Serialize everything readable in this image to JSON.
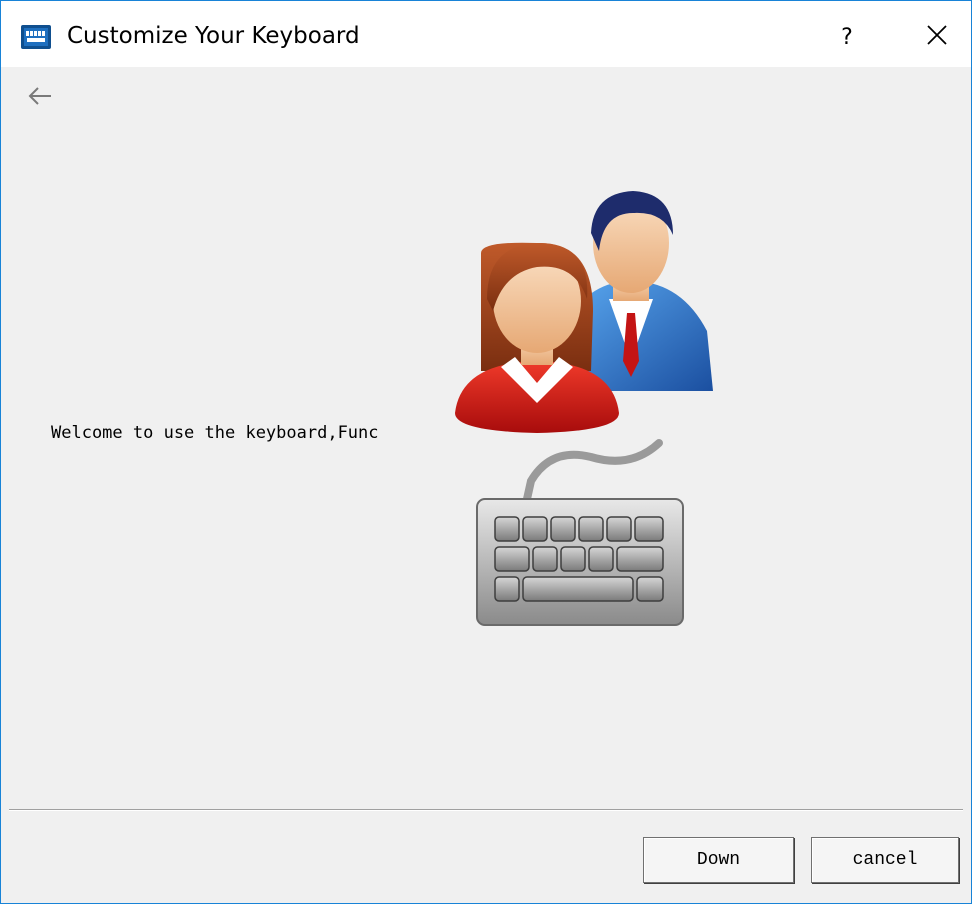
{
  "window": {
    "title": "Customize Your Keyboard",
    "help_label": "?",
    "accent_color": "#1883d7"
  },
  "icons": {
    "app": "keyboard-app-icon",
    "back": "arrow-left-icon",
    "close": "close-icon",
    "illustration": "users-keyboard-illustration"
  },
  "content": {
    "welcome_text": "Welcome to use the keyboard,Func"
  },
  "footer": {
    "down_label": "Down",
    "cancel_label": "cancel"
  }
}
